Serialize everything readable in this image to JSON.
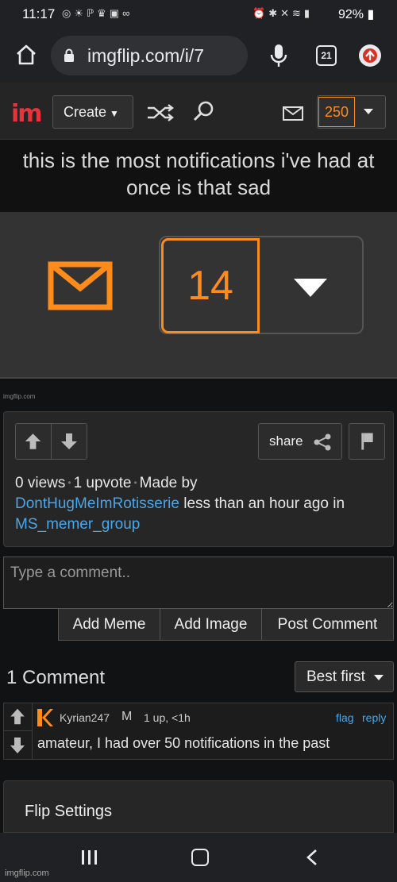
{
  "status_bar": {
    "time": "11:17",
    "battery": "92%",
    "icons_left": [
      "circle-icon",
      "brightness-icon",
      "nfc-icon",
      "crown-icon",
      "gallery-icon",
      "voicemail-icon"
    ],
    "icons_right": [
      "alarm-icon",
      "bluetooth-icon",
      "mute-icon",
      "wifi-icon",
      "signal-icon",
      "battery-icon"
    ]
  },
  "browser": {
    "url": "imgflip.com/i/7",
    "tab_count": "21"
  },
  "navbar": {
    "logo": "im",
    "create_label": "Create",
    "notification_count": "250",
    "colors": {
      "accent": "#ff8c1a",
      "logo": "#e8323c"
    }
  },
  "meme": {
    "title": "this is the most notifications i've had at once is that sad",
    "image_notification_count": "14",
    "image_watermark": "imgflip.com"
  },
  "info": {
    "share_label": "share",
    "views": "0 views",
    "upvotes": "1 upvote",
    "made_by": "Made by",
    "author": "DontHugMeImRotisserie",
    "time_text": "less than an hour ago in",
    "stream": "MS_memer_group"
  },
  "comment_box": {
    "placeholder": "Type a comment..",
    "add_meme": "Add Meme",
    "add_image": "Add Image",
    "post_comment": "Post Comment"
  },
  "comments": {
    "count_label": "1 Comment",
    "sort_label": "Best first",
    "items": [
      {
        "username": "Kyrian247",
        "badge": "M",
        "meta": "1 up, <1h",
        "flag": "flag",
        "reply": "reply",
        "text": "amateur, I had over 50 notifications in the past"
      }
    ]
  },
  "flip_settings": {
    "label": "Flip Settings"
  },
  "footer_watermark": "imgflip.com"
}
